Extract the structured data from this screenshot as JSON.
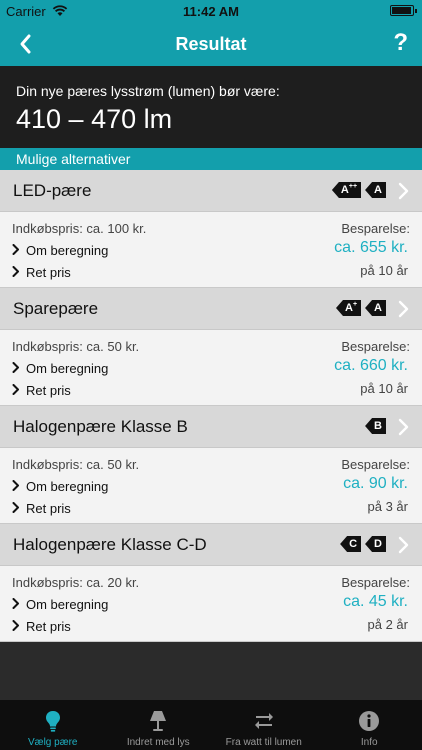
{
  "status": {
    "carrier": "Carrier",
    "time": "11:42 AM"
  },
  "nav": {
    "title": "Resultat",
    "help": "?"
  },
  "result": {
    "label": "Din nye pæres lysstrøm (lumen) bør være:",
    "value": "410 – 470 lm"
  },
  "alternatives_header": "Mulige alternativer",
  "items": [
    {
      "name": "LED-pære",
      "labels": [
        {
          "t": "A",
          "s": "++"
        },
        {
          "t": "A",
          "s": ""
        }
      ],
      "price": "Indkøbspris: ca. 100 kr.",
      "calc": "Om beregning",
      "fix": "Ret pris",
      "save_label": "Besparelse:",
      "saving": "ca. 655 kr.",
      "period": "på 10 år"
    },
    {
      "name": "Sparepære",
      "labels": [
        {
          "t": "A",
          "s": "+"
        },
        {
          "t": "A",
          "s": ""
        }
      ],
      "price": "Indkøbspris: ca. 50 kr.",
      "calc": "Om beregning",
      "fix": "Ret pris",
      "save_label": "Besparelse:",
      "saving": "ca. 660 kr.",
      "period": "på 10 år"
    },
    {
      "name": "Halogenpære Klasse B",
      "labels": [
        {
          "t": "B",
          "s": ""
        }
      ],
      "price": "Indkøbspris: ca. 50 kr.",
      "calc": "Om beregning",
      "fix": "Ret pris",
      "save_label": "Besparelse:",
      "saving": "ca. 90 kr.",
      "period": "på 3 år"
    },
    {
      "name": "Halogenpære Klasse C-D",
      "labels": [
        {
          "t": "C",
          "s": ""
        },
        {
          "t": "D",
          "s": ""
        }
      ],
      "price": "Indkøbspris: ca. 20 kr.",
      "calc": "Om beregning",
      "fix": "Ret pris",
      "save_label": "Besparelse:",
      "saving": "ca. 45 kr.",
      "period": "på 2 år"
    }
  ],
  "tabs": [
    {
      "label": "Vælg pære",
      "icon": "bulb-icon",
      "active": true
    },
    {
      "label": "Indret med lys",
      "icon": "lamp-icon",
      "active": false
    },
    {
      "label": "Fra watt til lumen",
      "icon": "convert-icon",
      "active": false
    },
    {
      "label": "Info",
      "icon": "info-icon",
      "active": false
    }
  ],
  "colors": {
    "accent": "#139fac",
    "saving": "#1fb0c2",
    "panel": "#1e1e1e",
    "tabbar": "#0e0e0e"
  }
}
